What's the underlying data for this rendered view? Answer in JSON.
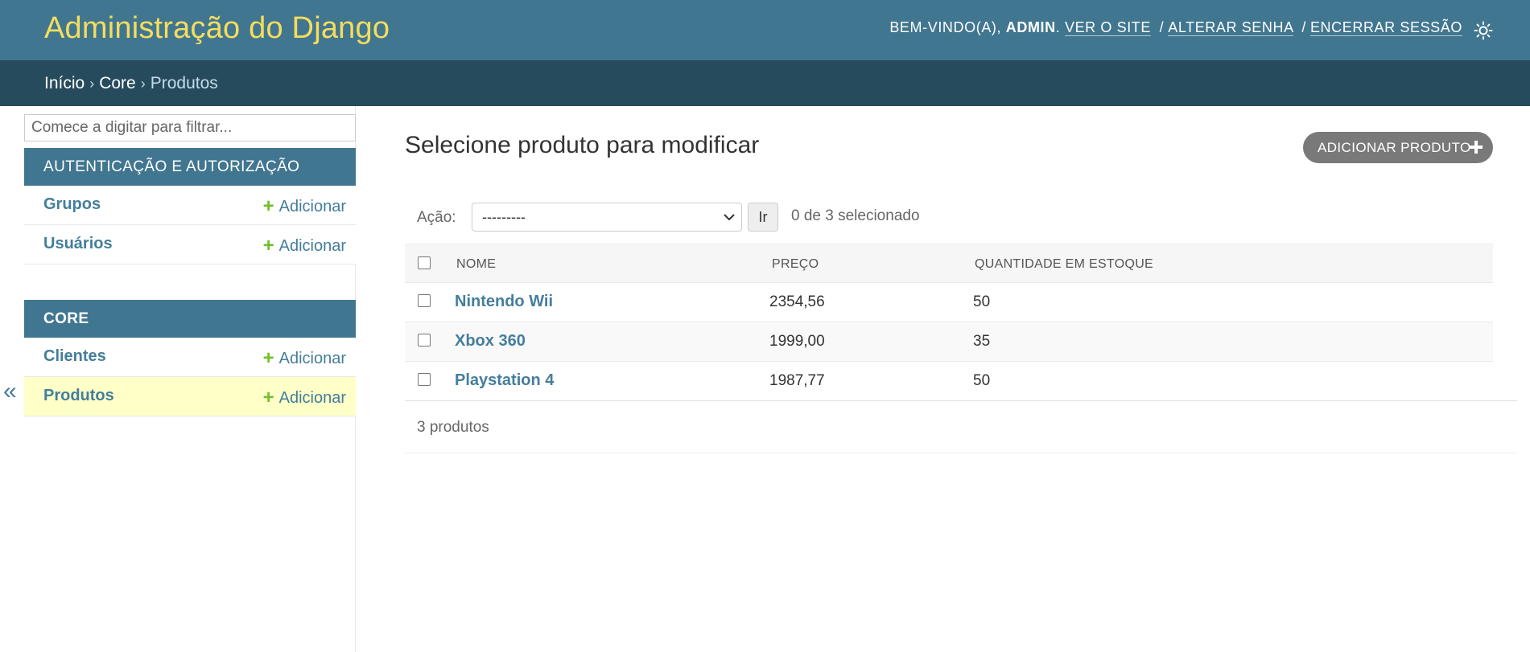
{
  "header": {
    "brand": "Administração do Django",
    "welcome": "Bem-vindo(a),",
    "username": "admin",
    "links": {
      "view_site": "Ver o site",
      "change_password": "Alterar senha",
      "logout": "Encerrar sessão"
    },
    "separator": "/",
    "theme_icon": "sun-icon"
  },
  "breadcrumbs": {
    "items": [
      "Início",
      "Core"
    ],
    "current": "Produtos",
    "separator": "›"
  },
  "sidebar": {
    "filter_placeholder": "Comece a digitar para filtrar...",
    "add_label": "Adicionar",
    "collapse_symbol": "«",
    "modules": [
      {
        "caption": "Autenticação e Autorização",
        "models": [
          "Grupos",
          "Usuários"
        ]
      },
      {
        "caption": "Core",
        "models": [
          "Clientes",
          "Produtos"
        ]
      }
    ],
    "current_model": "Produtos"
  },
  "content": {
    "title": "Selecione produto para modificar",
    "add_button": "Adicionar Produto",
    "actions": {
      "label": "Ação:",
      "selected_value": "---------",
      "go_label": "Ir",
      "selected_count": "0 de 3 selecionado"
    },
    "table": {
      "columns": [
        "Nome",
        "Preço",
        "Quantidade em estoque"
      ],
      "rows": [
        {
          "name": "Nintendo Wii",
          "price": "2354,56",
          "stock": "50"
        },
        {
          "name": "Xbox 360",
          "price": "1999,00",
          "stock": "35"
        },
        {
          "name": "Playstation 4",
          "price": "1987,77",
          "stock": "50"
        }
      ]
    },
    "paginator": "3 produtos"
  },
  "colors": {
    "header_bg": "#417690",
    "breadcrumbs_bg": "#264b5d",
    "brand": "#f5dd5d",
    "link": "#447e9b",
    "add_green": "#70bf2b",
    "current_row": "#ffffc8"
  }
}
